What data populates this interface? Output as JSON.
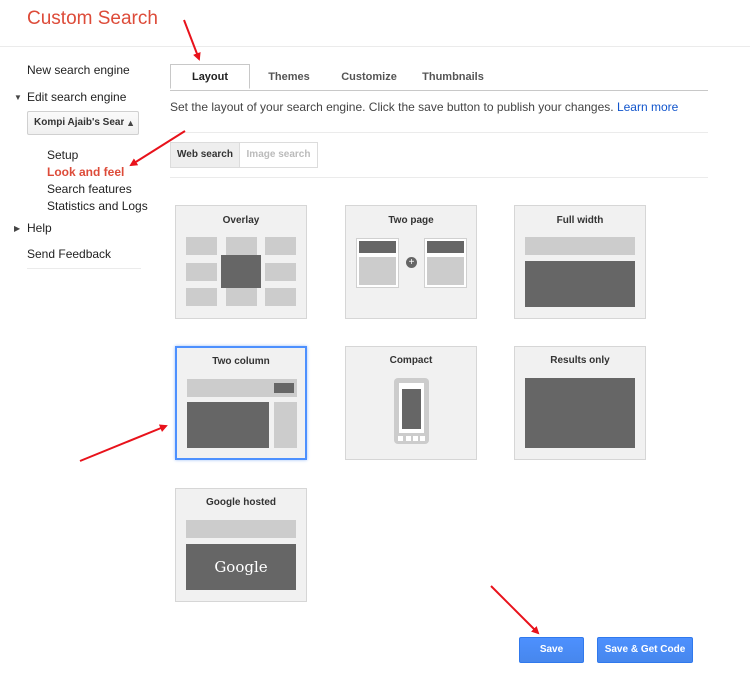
{
  "app": {
    "title": "Custom Search"
  },
  "sidebar": {
    "new_engine": "New search engine",
    "edit_engine": "Edit search engine",
    "engine_select": "Kompi Ajaib's Sear",
    "subitems": [
      "Setup",
      "Look and feel",
      "Search features",
      "Statistics and Logs"
    ],
    "help": "Help",
    "feedback": "Send Feedback"
  },
  "tabs": [
    {
      "label": "Layout",
      "active": true
    },
    {
      "label": "Themes",
      "active": false
    },
    {
      "label": "Customize",
      "active": false
    },
    {
      "label": "Thumbnails",
      "active": false
    }
  ],
  "layout_description": "Set the layout of your search engine. Click the save button to publish your changes.",
  "learn_more": "Learn more",
  "subtabs": {
    "web": "Web search",
    "image": "Image search"
  },
  "layouts": [
    {
      "label": "Overlay",
      "selected": false
    },
    {
      "label": "Two page",
      "selected": false
    },
    {
      "label": "Full width",
      "selected": false
    },
    {
      "label": "Two column",
      "selected": true
    },
    {
      "label": "Compact",
      "selected": false
    },
    {
      "label": "Results only",
      "selected": false
    },
    {
      "label": "Google hosted",
      "selected": false
    }
  ],
  "google_logo": "Google",
  "buttons": {
    "save": "Save",
    "save_get_code": "Save & Get Code"
  },
  "colors": {
    "accent_red": "#dd4b39",
    "button_blue": "#4d90fe",
    "link_blue": "#1155cc",
    "annotation_arrow": "#e8121b"
  }
}
